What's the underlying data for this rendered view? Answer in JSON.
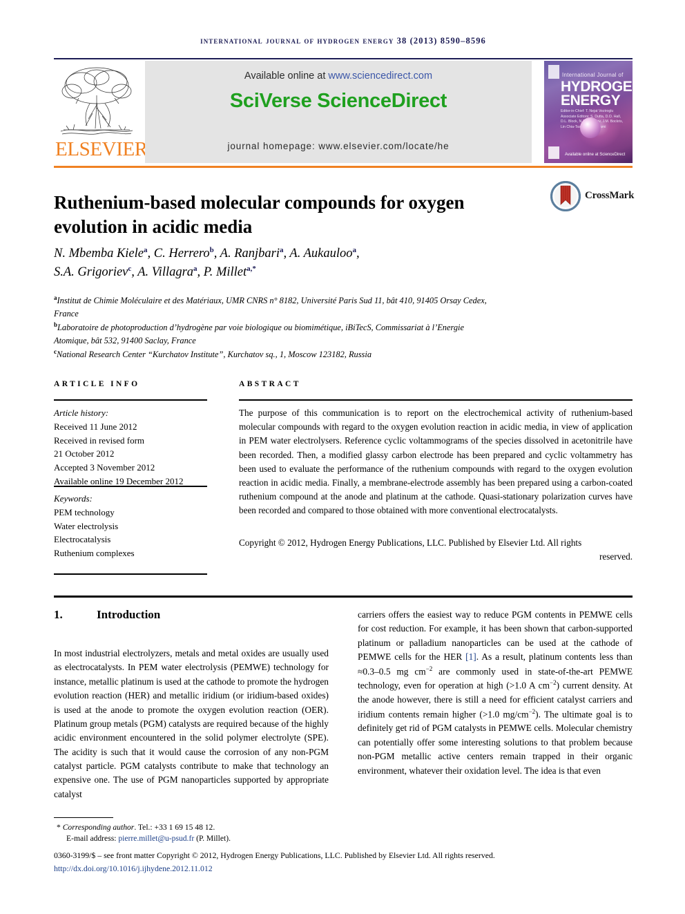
{
  "running_head": "International Journal of Hydrogen Energy 38 (2013) 8590–8596",
  "masthead": {
    "publisher_name": "ELSEVIER",
    "available_prefix": "Available online at ",
    "available_url": "www.sciencedirect.com",
    "platform_logo": "SciVerse ScienceDirect",
    "homepage": "journal homepage: www.elsevier.com/locate/he",
    "cover": {
      "top_line": "International Journal of",
      "title_line1": "HYDROGEN",
      "title_line2": "ENERGY",
      "editors": "Editor-in-Chief: T. Nejat Veziroglu   Associate Editors: S. Dutta, D.O. Hall, D.L. Block, N.Z. Muradov, J.M. Bockris, Lin Chia-Tsai, D.Y. Goswami",
      "science_direct_mark": "Available online at ScienceDirect"
    }
  },
  "crossmark": {
    "label": "CrossMark",
    "ring_color": "#5c7f9e",
    "ribbon_color": "#b3291f"
  },
  "article": {
    "title": "Ruthenium-based molecular compounds for oxygen evolution in acidic media",
    "authors_line1": "N. Mbemba Kiele",
    "authors_html_1": "N. Mbemba Kiele<sup>a</sup>, C. Herrero<sup>b</sup>, A. Ranjbari<sup>a</sup>, A. Aukauloo<sup>a</sup>,",
    "authors_html_2": "S.A. Grigoriev<sup>c</sup>, A. Villagra<sup>a</sup>, P. Millet<sup>a,*</sup>",
    "affiliations": [
      "Institut de Chimie Moléculaire et des Matériaux, UMR CNRS n° 8182, Université Paris Sud 11, bât 410, 91405 Orsay Cedex, France",
      "Laboratoire de photoproduction d’hydrogène par voie biologique ou biomimétique, iBiTecS, Commissariat à l’Energie Atomique, bât 532, 91400 Saclay, France",
      "National Research Center “Kurchatov Institute”, Kurchatov sq., 1, Moscow 123182, Russia"
    ],
    "affiliation_markers": [
      "a",
      "b",
      "c"
    ]
  },
  "info": {
    "heading": "ARTICLE INFO",
    "history_label": "Article history:",
    "history": [
      "Received 11 June 2012",
      "Received in revised form",
      "21 October 2012",
      "Accepted 3 November 2012",
      "Available online 19 December 2012"
    ],
    "keywords_label": "Keywords:",
    "keywords": [
      "PEM technology",
      "Water electrolysis",
      "Electrocatalysis",
      "Ruthenium complexes"
    ]
  },
  "abstract": {
    "heading": "ABSTRACT",
    "body": "The purpose of this communication is to report on the electrochemical activity of ruthenium-based molecular compounds with regard to the oxygen evolution reaction in acidic media, in view of application in PEM water electrolysers. Reference cyclic voltammograms of the species dissolved in acetonitrile have been recorded. Then, a modified glassy carbon electrode has been prepared and cyclic voltammetry has been used to evaluate the performance of the ruthenium compounds with regard to the oxygen evolution reaction in acidic media. Finally, a membrane-electrode assembly has been prepared using a carbon-coated ruthenium compound at the anode and platinum at the cathode. Quasi-stationary polarization curves have been recorded and compared to those obtained with more conventional electrocatalysts.",
    "copyright_main": "Copyright © 2012, Hydrogen Energy Publications, LLC. Published by Elsevier Ltd. All rights",
    "copyright_last": "reserved."
  },
  "section": {
    "number": "1.",
    "title": "Introduction"
  },
  "body": {
    "left_column": "In most industrial electrolyzers, metals and metal oxides are usually used as electrocatalysts. In PEM water electrolysis (PEMWE) technology for instance, metallic platinum is used at the cathode to promote the hydrogen evolution reaction (HER) and metallic iridium (or iridium-based oxides) is used at the anode to promote the oxygen evolution reaction (OER). Platinum group metals (PGM) catalysts are required because of the highly acidic environment encountered in the solid polymer electrolyte (SPE). The acidity is such that it would cause the corrosion of any non-PGM catalyst particle. PGM catalysts contribute to make that technology an expensive one. The use of PGM nanoparticles supported by appropriate catalyst",
    "right_column_part1": "carriers offers the easiest way to reduce PGM contents in PEMWE cells for cost reduction. For example, it has been shown that carbon-supported platinum or palladium nanoparticles can be used at the cathode of PEMWE cells for the HER ",
    "right_reference": "[1]",
    "right_column_part2": ". As a result, platinum contents less than ≈0.3–0.5 mg cm",
    "right_sup1": "−2",
    "right_column_part3": " are commonly used in state-of-the-art PEMWE technology, even for operation at high (>1.0 A cm",
    "right_sup2": "−2",
    "right_column_part4": ") current density. At the anode however, there is still a need for efficient catalyst carriers and iridium contents remain higher (>1.0 mg/cm",
    "right_sup3": "−2",
    "right_column_part5": "). The ultimate goal is to definitely get rid of PGM catalysts in PEMWE cells. Molecular chemistry can potentially offer some interesting solutions to that problem because non-PGM metallic active centers remain trapped in their organic environment, whatever their oxidation level. The idea is that even"
  },
  "footer": {
    "corresponding_marker": "*",
    "corresponding_label": "Corresponding author",
    "corresponding_tel": ". Tel.: +33 1 69 15 48 12.",
    "email_label": "E-mail address: ",
    "email": "pierre.millet@u-psud.fr",
    "email_suffix": " (P. Millet).",
    "issn_line": "0360-3199/$ – see front matter Copyright © 2012, Hydrogen Energy Publications, LLC. Published by Elsevier Ltd. All rights reserved.",
    "doi": "http://dx.doi.org/10.1016/j.ijhydene.2012.11.012"
  },
  "colors": {
    "navy": "#1b1b54",
    "elsevier_orange": "#f08122",
    "sciencedirect_green": "#1fa01f",
    "link_blue": "#1b3e87",
    "band_gray": "#e4e4e4"
  }
}
